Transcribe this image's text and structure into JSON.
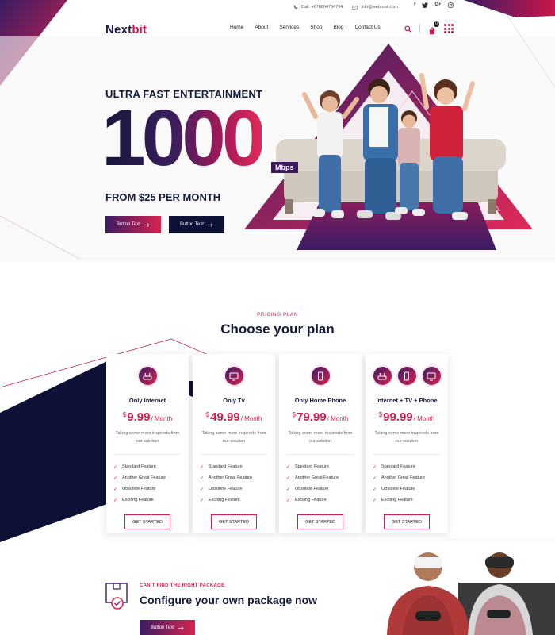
{
  "colors": {
    "navy": "#171b3d",
    "accent": "#d3214d",
    "purple": "#3a1c63",
    "dark_button": "#0e1136"
  },
  "topbar": {
    "phone_icon": "phone-icon",
    "phone": "Call: +876864764764",
    "mail_icon": "envelope-icon",
    "email": "info@webmail.com",
    "social": [
      "facebook-icon",
      "twitter-icon",
      "google-plus-icon",
      "instagram-icon"
    ],
    "social_labels": [
      "f",
      "",
      "G+",
      ""
    ]
  },
  "header": {
    "logo_part1": "Next",
    "logo_part2": "bit",
    "nav": [
      "Home",
      "About",
      "Services",
      "Shop",
      "Blog",
      "Contact Us"
    ],
    "cart_count": "0"
  },
  "hero": {
    "subtitle": "ULTRA FAST ENTERTAINMENT",
    "speed": "1000",
    "unit": "Mbps",
    "price_line": "FROM $25 PER MONTH",
    "button1": "Button Text",
    "button2": "Button Text"
  },
  "pricing": {
    "eyebrow": "PRICING PLAN",
    "title": "Choose your plan",
    "plans": [
      {
        "name": "Only Internet",
        "currency": "$",
        "amount": "9.99",
        "period": "/ Month",
        "desc": "Taking some more inspireds from our solution",
        "icons": [
          "router-icon"
        ],
        "features": [
          "Standard Feature",
          "Another Great Feature",
          "Obsolete Feature",
          "Exciting Feature"
        ],
        "cta": "GET STARTED"
      },
      {
        "name": "Only Tv",
        "currency": "$",
        "amount": "49.99",
        "period": "/ Month",
        "desc": "Taking some more inspireds from our solution",
        "icons": [
          "tv-icon"
        ],
        "features": [
          "Standard Feature",
          "Another Great Feature",
          "Obsolete Feature",
          "Exciting Feature"
        ],
        "cta": "GET STARTED"
      },
      {
        "name": "Only Home Phone",
        "currency": "$",
        "amount": "79.99",
        "period": "/ Month",
        "desc": "Taking some more inspireds from our solution",
        "icons": [
          "phone-icon"
        ],
        "features": [
          "Standard Feature",
          "Another Great Feature",
          "Obsolete Feature",
          "Exciting Feature"
        ],
        "cta": "GET STARTED"
      },
      {
        "name": "Internet + TV + Phone",
        "currency": "$",
        "amount": "99.99",
        "period": "/ Month",
        "desc": "Taking some more inspireds from our solution",
        "icons": [
          "router-icon",
          "phone-icon",
          "tv-icon"
        ],
        "features": [
          "Standard Feature",
          "Another Great Feature",
          "Obsolete Feature",
          "Exciting Feature"
        ],
        "cta": "GET STARTED"
      }
    ]
  },
  "bottom": {
    "eyebrow": "CAN'T FIND THE RIGHT PACKAGE",
    "title": "Configure your own package now",
    "button": "Button Text"
  }
}
